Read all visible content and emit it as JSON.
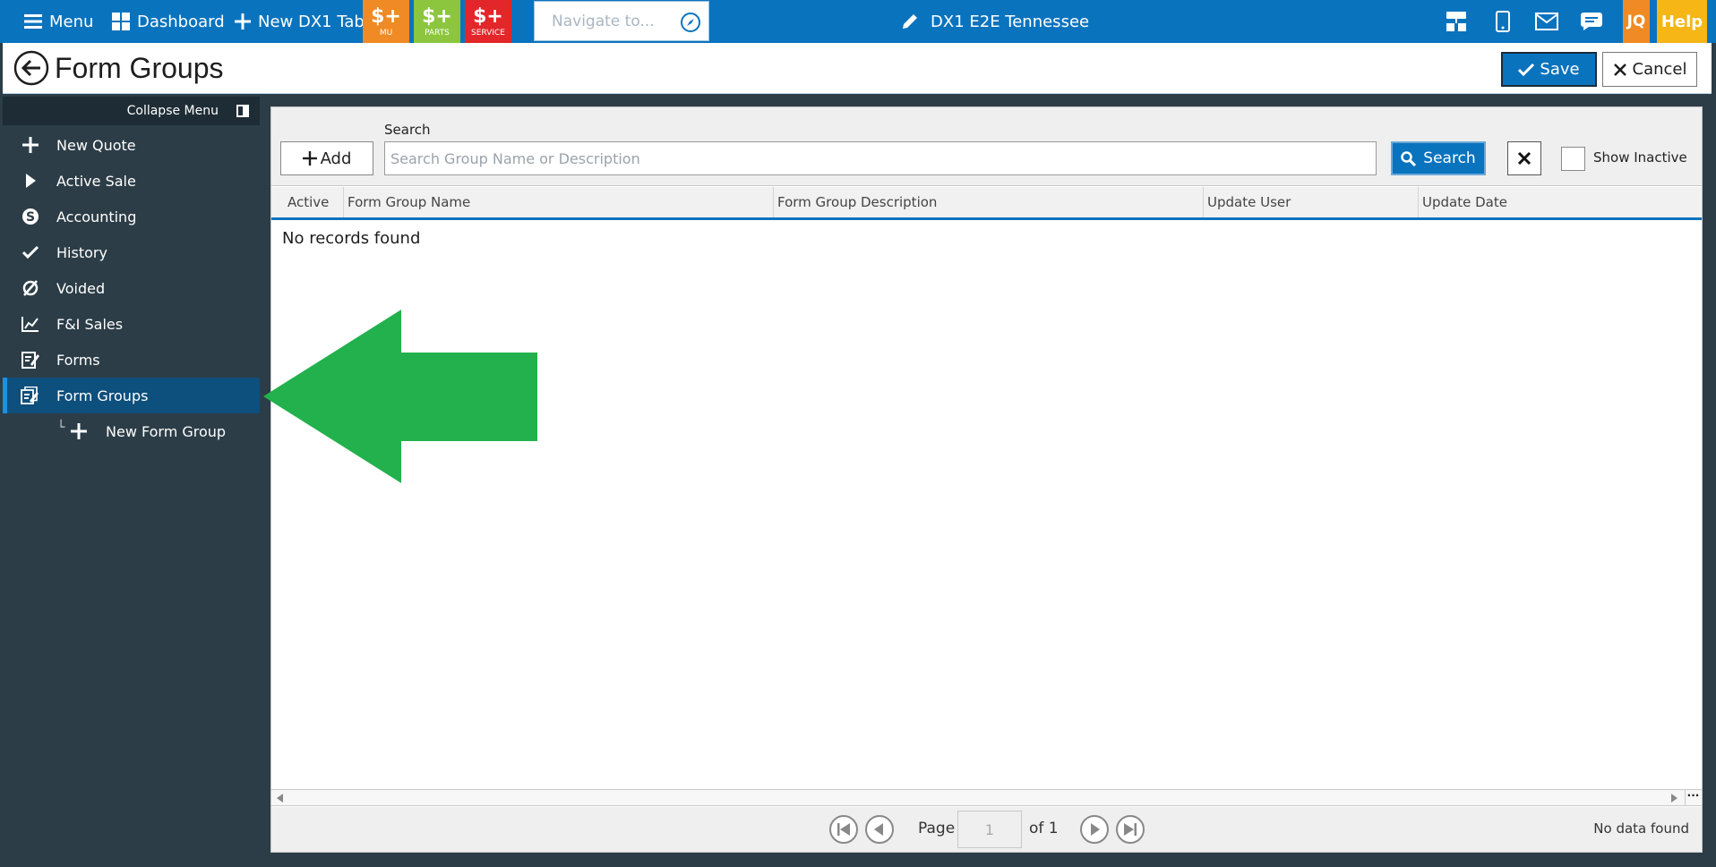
{
  "topbar": {
    "menu_label": "Menu",
    "dashboard_label": "Dashboard",
    "new_tab_label": "New DX1 Tab",
    "apps": [
      {
        "label": "MU",
        "color": "#ef8a24"
      },
      {
        "label": "PARTS",
        "color": "#8cc63f"
      },
      {
        "label": "SERVICE",
        "color": "#e3262a"
      }
    ],
    "navigate_placeholder": "Navigate to...",
    "dealer_name": "DX1 E2E Tennessee",
    "user_initials": "JQ",
    "help_label": "Help"
  },
  "titlebar": {
    "title": "Form Groups",
    "save_label": "Save",
    "cancel_label": "Cancel"
  },
  "sidebar": {
    "collapse_label": "Collapse Menu",
    "items": [
      {
        "label": "New Quote",
        "icon": "plus-icon"
      },
      {
        "label": "Active Sale",
        "icon": "play-icon"
      },
      {
        "label": "Accounting",
        "icon": "dollar-circle-icon"
      },
      {
        "label": "History",
        "icon": "check-icon"
      },
      {
        "label": "Voided",
        "icon": "empty-set-icon"
      },
      {
        "label": "F&I Sales",
        "icon": "line-chart-icon"
      },
      {
        "label": "Forms",
        "icon": "form-edit-icon"
      },
      {
        "label": "Form Groups",
        "icon": "form-group-icon",
        "active": true
      },
      {
        "label": "New Form Group",
        "icon": "plus-icon",
        "sub": true
      }
    ]
  },
  "toolbar": {
    "add_label": "Add",
    "search_label": "Search",
    "search_placeholder": "Search Group Name or Description",
    "search_button_label": "Search",
    "show_inactive_label": "Show Inactive"
  },
  "grid": {
    "columns": [
      "Active",
      "Form Group Name",
      "Form Group Description",
      "Update User",
      "Update Date"
    ],
    "empty_message": "No records found"
  },
  "pager": {
    "page_label": "Page",
    "page_value": "1",
    "of_label": "of 1",
    "status": "No data found"
  },
  "colors": {
    "accent": "#0a73be",
    "sidebar": "#2c3d47",
    "active_item": "#0d4f7d",
    "annotation_arrow": "#22b14c"
  }
}
